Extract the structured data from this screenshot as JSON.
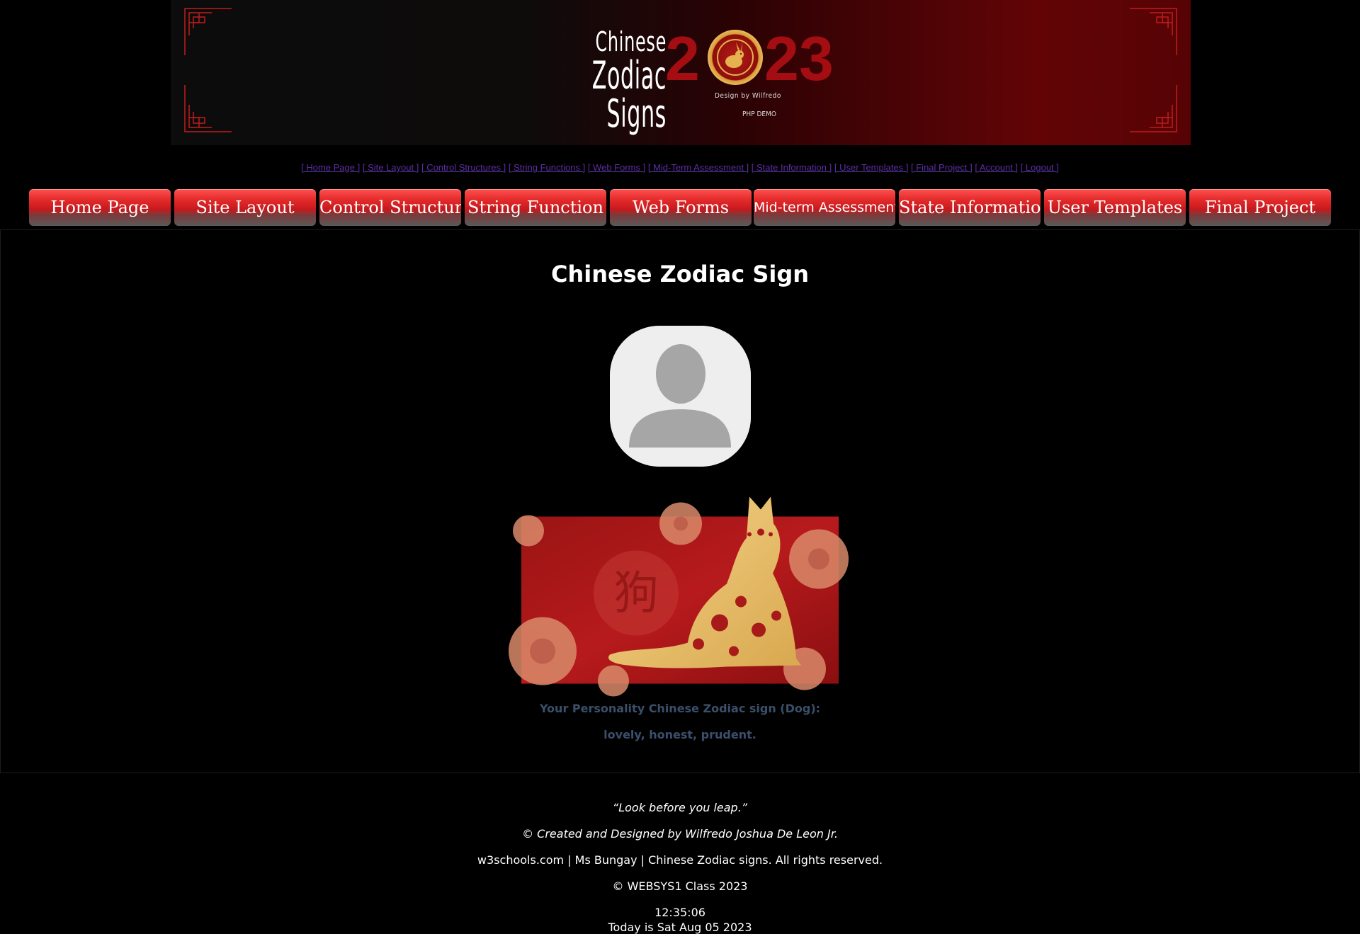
{
  "banner": {
    "logo_line1": "Chinese",
    "logo_line2": "Zodiac Signs",
    "year_digit_1": "2",
    "year_digits_rest": "23",
    "design_by": "Design by Wilfredo",
    "php_demo": "PHP DEMO",
    "accent_color": "#a40d12"
  },
  "text_nav": [
    "[ Home Page ]",
    "[ Site Layout ]",
    "[ Control Structures ]",
    "[ String Functions ]",
    "[ Web  Forms ]",
    "[ Mid-Term Assessment ]",
    "[ State Information ]",
    "[ User Templates ]",
    "[ Final Project ]",
    "[ Account ]",
    "[ Logout ]"
  ],
  "button_nav": [
    "Home Page",
    "Site Layout",
    "Control Structure",
    "String Function",
    "Web Forms",
    "Mid-term Assessment",
    "State Information",
    "User Templates",
    "Final Project"
  ],
  "main": {
    "title": "Chinese Zodiac Sign",
    "zodiac_character": "狗",
    "personality_line": "Your Personality Chinese Zodiac sign (Dog):",
    "traits_line": "lovely, honest, prudent."
  },
  "footer": {
    "quote": "“Look before you leap.”",
    "credit": "© Created and Designed by Wilfredo Joshua De Leon Jr.",
    "rights": "w3schools.com | Ms Bungay | Chinese Zodiac signs. All rights reserved.",
    "class": "© WEBSYS1 Class 2023",
    "time": "12:35:06",
    "date": "Today is Sat Aug 05 2023"
  }
}
